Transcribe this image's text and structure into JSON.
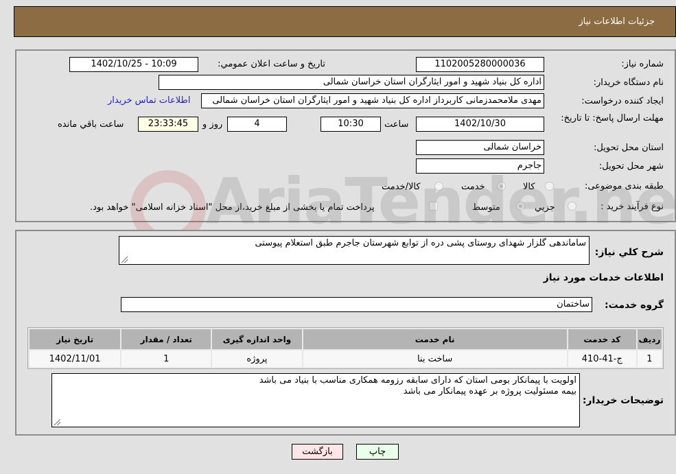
{
  "header": {
    "title": "جزئیات اطلاعات نیاز"
  },
  "form": {
    "need_number": {
      "label": "شماره نیاز:",
      "value": "1102005280000036"
    },
    "announce_datetime": {
      "label": "تاریخ و ساعت اعلان عمومي:",
      "value": "1402/10/25 - 10:09"
    },
    "buyer_org": {
      "label": "نام دستگاه خریدار:",
      "value": "اداره کل بنیاد شهید و امور ایثارگران استان خراسان شمالی"
    },
    "requester": {
      "label": "ایجاد کننده درخواست:",
      "value": "مهدی  ملامحمدزمانی کاربرداز اداره کل بنیاد شهید و امور ایثارگران استان خراسان شمالی"
    },
    "buyer_contact_link": "اطلاعات تماس خریدار",
    "deadline": {
      "label": "مهلت ارسال پاسخ: تا تاریخ:",
      "date": "1402/10/30",
      "time_label": "ساعت",
      "time": "10:30",
      "days": "4",
      "days_label": "روز و",
      "remaining": "23:33:45",
      "remaining_label": "ساعت باقي مانده"
    },
    "delivery_province": {
      "label": "استان محل تحویل:",
      "value": "خراسان شمالی"
    },
    "delivery_city": {
      "label": "شهر محل تحویل:",
      "value": "جاجرم"
    },
    "category": {
      "label": "طبقه بندی موضوعی:",
      "options": [
        "کالا",
        "خدمت",
        "کالا/خدمت"
      ],
      "selected": "خدمت"
    },
    "purchase_type": {
      "label": "نوع فرآیند خرید :",
      "options": [
        "جزيي",
        "متوسط"
      ],
      "selected": "متوسط",
      "payment_note": "پرداخت تمام یا بخشی از مبلغ خرید،از محل \"اسناد خزانه اسلامی\" خواهد بود."
    }
  },
  "description": {
    "label": "شرح کلي نیاز:",
    "value": "ساماندهی گلزار شهدای روستای پشی دره از توابع شهرستان جاجرم طبق استعلام پیوستی"
  },
  "services": {
    "section_title": "اطلاعات خدمات مورد نیاز",
    "group_label": "گروه خدمت:",
    "group_value": "ساختمان",
    "columns": [
      "ردیف",
      "کد خدمت",
      "نام خدمت",
      "واحد اندازه گیری",
      "تعداد / مقدار",
      "تاریخ نیاز"
    ],
    "rows": [
      [
        "1",
        "ج-41-410",
        "ساخت بنا",
        "پروژه",
        "1",
        "1402/11/01"
      ]
    ]
  },
  "buyer_notes": {
    "label": "توضیحات خریدار:",
    "lines": [
      "اولویت با پیمانکار بومی استان که دارای سابقه رزومه همکاری مناسب با بنیاد می باشد",
      "بیمه مسئولیت پروژه بر عهده پیمانکار می باشد"
    ]
  },
  "buttons": {
    "back": "بازگشت",
    "print": "چاپ"
  },
  "watermark": {
    "text": "AriaTender.neT"
  }
}
